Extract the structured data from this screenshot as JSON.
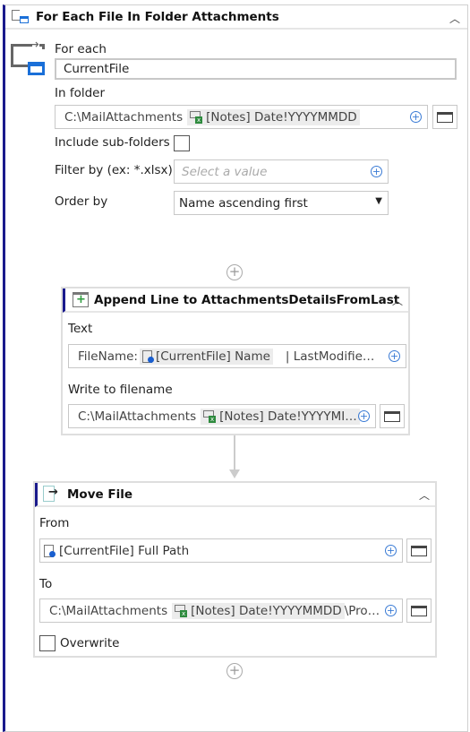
{
  "loop": {
    "title": "For Each File In Folder Attachments",
    "for_each_label": "For each",
    "for_each_value": "CurrentFile",
    "in_folder_label": "In folder",
    "in_folder_prefix": "C:\\MailAttachments",
    "in_folder_token": "[Notes] Date!YYYYMMDD",
    "include_subfolders_label": "Include sub-folders",
    "include_subfolders_checked": false,
    "filter_label": "Filter by (ex: *.xlsx)",
    "filter_placeholder": "Select a value",
    "order_label": "Order by",
    "order_value": "Name ascending first"
  },
  "append": {
    "title": "Append Line to AttachmentsDetailsFromLast",
    "text_label": "Text",
    "text_prefix": "FileName:",
    "text_token": "[CurrentFile] Name",
    "text_suffix": "|   LastModifie…",
    "write_label": "Write to filename",
    "write_prefix": "C:\\MailAttachments",
    "write_token": "[Notes] Date!YYYYMI…"
  },
  "move": {
    "title": "Move File",
    "from_label": "From",
    "from_token": "[CurrentFile] Full Path",
    "to_label": "To",
    "to_prefix": "C:\\MailAttachments",
    "to_token": "[Notes] Date!YYYYMMDD",
    "to_suffix": "\\Pro…",
    "overwrite_label": "Overwrite",
    "overwrite_checked": false
  },
  "accent_color": "#1a1a8c"
}
